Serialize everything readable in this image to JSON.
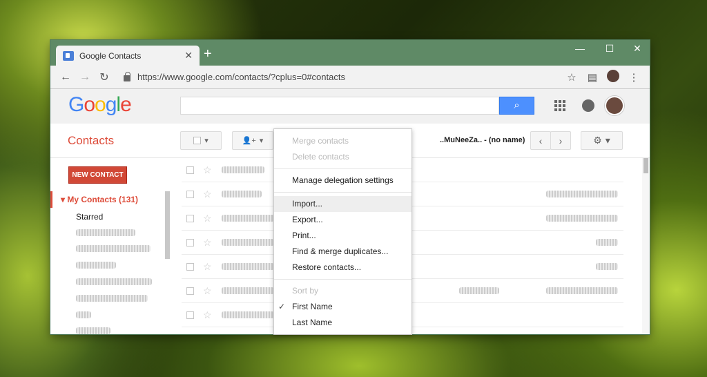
{
  "browser": {
    "tab_title": "Google Contacts",
    "url": "https://www.google.com/contacts/?cplus=0#contacts"
  },
  "header": {
    "logo": [
      "G",
      "o",
      "o",
      "g",
      "l",
      "e"
    ]
  },
  "toolbar": {
    "title": "Contacts",
    "pager_text": "..MuNeeZa.. - (no name)"
  },
  "sidebar": {
    "new_contact": "NEW CONTACT",
    "my_contacts": "My Contacts (131)",
    "starred": "Starred"
  },
  "menu": {
    "merge": "Merge contacts",
    "delete": "Delete contacts",
    "delegation": "Manage delegation settings",
    "import": "Import...",
    "export": "Export...",
    "print": "Print...",
    "find_merge": "Find & merge duplicates...",
    "restore": "Restore contacts...",
    "sort_by": "Sort by",
    "first_name": "First Name",
    "last_name": "Last Name"
  },
  "colors": {
    "accent": "#dd4b39",
    "search_button": "#4d90fe",
    "titlebar": "#5f8a66"
  },
  "icons": [
    "search-icon",
    "apps-icon",
    "notifications-icon",
    "gear-icon",
    "add-person-icon",
    "star-icon",
    "back-icon",
    "forward-icon",
    "reload-icon",
    "lock-icon",
    "bookmark-star-icon",
    "menu-icon"
  ]
}
